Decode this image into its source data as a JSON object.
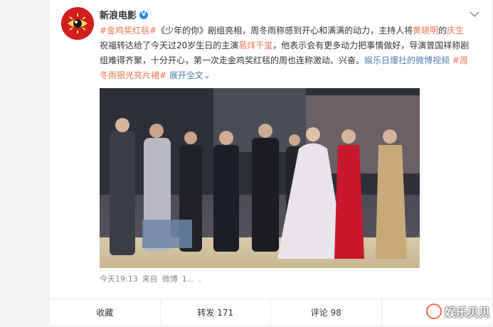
{
  "post": {
    "author": "新浪电影",
    "text_segments": [
      {
        "t": "#金鸡奖红毯#",
        "c": "tag"
      },
      {
        "t": "《少年的你》剧组亮相，周冬雨称感到开心和满满的动力，主持人将",
        "c": ""
      },
      {
        "t": "黄晓明",
        "c": "mention"
      },
      {
        "t": "的",
        "c": ""
      },
      {
        "t": "庆生",
        "c": "mention"
      },
      {
        "t": "祝福转达给了今天过20岁生日的主演",
        "c": ""
      },
      {
        "t": "易烊千玺",
        "c": "mention"
      },
      {
        "t": "，他表示会有更多动力把事情做好，导演曾国祥称剧组难得齐聚，十分开心，第一次走金鸡奖红毯的周也连称激动、兴奋。",
        "c": ""
      },
      {
        "t": "娱乐日爆社的微博视频",
        "c": "link"
      },
      {
        "t": " ",
        "c": ""
      },
      {
        "t": "#周冬雨银光亮片裙#",
        "c": "tag"
      },
      {
        "t": " ",
        "c": ""
      },
      {
        "t": "展开全文",
        "c": "link"
      },
      {
        "t": "⌄",
        "c": "link"
      }
    ],
    "time": "今天19:13",
    "via_prefix": "来自",
    "via": "微博",
    "via_tail": "1...",
    "via_end": "."
  },
  "actions": {
    "favorite": "收藏",
    "repost": "转发 171",
    "comment": "评论 98",
    "like": ""
  },
  "watermark": "娱乐贝贝",
  "colors": {
    "tag": "#eb7350",
    "link": "#507daf",
    "avatar": "#d41d1d"
  }
}
